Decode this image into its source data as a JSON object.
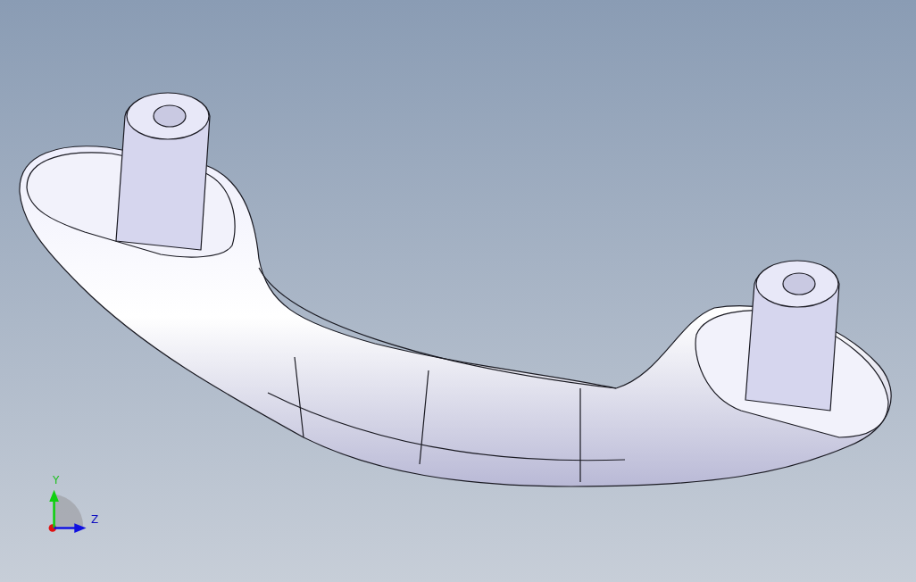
{
  "viewport": {
    "triad": {
      "y_label": "Y",
      "z_label": "Z"
    }
  }
}
